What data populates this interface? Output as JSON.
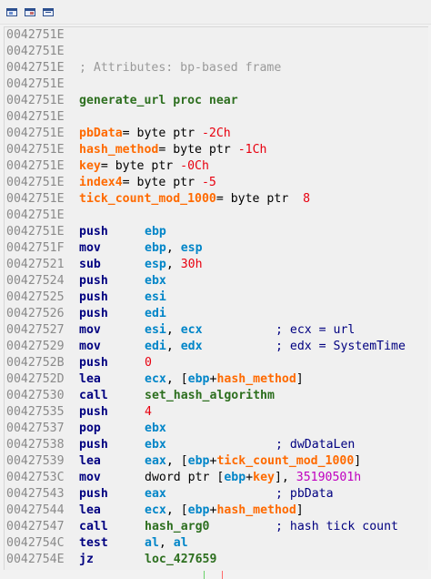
{
  "colors": {
    "address": "#8a8a8a",
    "comment_gray": "#9a9a9a",
    "procedure": "#2d6f1f",
    "variable": "#ff6a00",
    "number": "#e8000f",
    "register": "#0085c8",
    "immediate_big": "#c000c0",
    "mnemonic": "#000080"
  },
  "toolbar": {
    "icons": [
      "graph-view-icon",
      "proximity-view-icon",
      "text-view-icon"
    ]
  },
  "listing": [
    {
      "addr": "0042751E",
      "kind": "blank"
    },
    {
      "addr": "0042751E",
      "kind": "blank"
    },
    {
      "addr": "0042751E",
      "kind": "comment",
      "text": "; Attributes: bp-based frame"
    },
    {
      "addr": "0042751E",
      "kind": "blank"
    },
    {
      "addr": "0042751E",
      "kind": "proc",
      "text": "generate_url proc near"
    },
    {
      "addr": "0042751E",
      "kind": "blank"
    },
    {
      "addr": "0042751E",
      "kind": "var",
      "name": "pbData",
      "rest": "= byte ptr ",
      "off": "-2Ch"
    },
    {
      "addr": "0042751E",
      "kind": "var",
      "name": "hash_method",
      "rest": "= byte ptr ",
      "off": "-1Ch"
    },
    {
      "addr": "0042751E",
      "kind": "var",
      "name": "key",
      "rest": "= byte ptr ",
      "off": "-0Ch"
    },
    {
      "addr": "0042751E",
      "kind": "var",
      "name": "index4",
      "rest": "= byte ptr ",
      "off": "-5"
    },
    {
      "addr": "0042751E",
      "kind": "var",
      "name": "tick_count_mod_1000",
      "rest": "= byte ptr  ",
      "off": "8"
    },
    {
      "addr": "0042751E",
      "kind": "blank"
    },
    {
      "addr": "0042751E",
      "kind": "ins",
      "mn": "push",
      "ops": [
        [
          "ebp",
          "reg"
        ]
      ]
    },
    {
      "addr": "0042751F",
      "kind": "ins",
      "mn": "mov",
      "ops": [
        [
          "ebp",
          "reg"
        ],
        [
          ", ",
          "plain"
        ],
        [
          "esp",
          "reg"
        ]
      ]
    },
    {
      "addr": "00427521",
      "kind": "ins",
      "mn": "sub",
      "ops": [
        [
          "esp",
          "reg"
        ],
        [
          ", ",
          "plain"
        ],
        [
          "30h",
          "num"
        ]
      ]
    },
    {
      "addr": "00427524",
      "kind": "ins",
      "mn": "push",
      "ops": [
        [
          "ebx",
          "reg"
        ]
      ]
    },
    {
      "addr": "00427525",
      "kind": "ins",
      "mn": "push",
      "ops": [
        [
          "esi",
          "reg"
        ]
      ]
    },
    {
      "addr": "00427526",
      "kind": "ins",
      "mn": "push",
      "ops": [
        [
          "edi",
          "reg"
        ]
      ]
    },
    {
      "addr": "00427527",
      "kind": "ins",
      "mn": "mov",
      "ops": [
        [
          "esi",
          "reg"
        ],
        [
          ", ",
          "plain"
        ],
        [
          "ecx",
          "reg"
        ]
      ],
      "comment": "; ecx = url"
    },
    {
      "addr": "00427529",
      "kind": "ins",
      "mn": "mov",
      "ops": [
        [
          "edi",
          "reg"
        ],
        [
          ", ",
          "plain"
        ],
        [
          "edx",
          "reg"
        ]
      ],
      "comment": "; edx = SystemTime"
    },
    {
      "addr": "0042752B",
      "kind": "ins",
      "mn": "push",
      "ops": [
        [
          "0",
          "num"
        ]
      ]
    },
    {
      "addr": "0042752D",
      "kind": "ins",
      "mn": "lea",
      "ops": [
        [
          "ecx",
          "reg"
        ],
        [
          ", [",
          "plain"
        ],
        [
          "ebp",
          "reg"
        ],
        [
          "+",
          "plain"
        ],
        [
          "hash_method",
          "name"
        ],
        [
          "]",
          "plain"
        ]
      ]
    },
    {
      "addr": "00427530",
      "kind": "ins",
      "mn": "call",
      "ops": [
        [
          "set_hash_algorithm",
          "fn"
        ]
      ]
    },
    {
      "addr": "00427535",
      "kind": "ins",
      "mn": "push",
      "ops": [
        [
          "4",
          "num"
        ]
      ]
    },
    {
      "addr": "00427537",
      "kind": "ins",
      "mn": "pop",
      "ops": [
        [
          "ebx",
          "reg"
        ]
      ]
    },
    {
      "addr": "00427538",
      "kind": "ins",
      "mn": "push",
      "ops": [
        [
          "ebx",
          "reg"
        ]
      ],
      "comment": "; dwDataLen"
    },
    {
      "addr": "00427539",
      "kind": "ins",
      "mn": "lea",
      "ops": [
        [
          "eax",
          "reg"
        ],
        [
          ", [",
          "plain"
        ],
        [
          "ebp",
          "reg"
        ],
        [
          "+",
          "plain"
        ],
        [
          "tick_count_mod_1000",
          "name"
        ],
        [
          "]",
          "plain"
        ]
      ]
    },
    {
      "addr": "0042753C",
      "kind": "ins",
      "mn": "mov",
      "ops": [
        [
          "dword ptr [",
          "plain"
        ],
        [
          "ebp",
          "reg"
        ],
        [
          "+",
          "plain"
        ],
        [
          "key",
          "name"
        ],
        [
          "], ",
          "plain"
        ],
        [
          "35190501h",
          "big"
        ]
      ]
    },
    {
      "addr": "00427543",
      "kind": "ins",
      "mn": "push",
      "ops": [
        [
          "eax",
          "reg"
        ]
      ],
      "comment": "; pbData"
    },
    {
      "addr": "00427544",
      "kind": "ins",
      "mn": "lea",
      "ops": [
        [
          "ecx",
          "reg"
        ],
        [
          ", [",
          "plain"
        ],
        [
          "ebp",
          "reg"
        ],
        [
          "+",
          "plain"
        ],
        [
          "hash_method",
          "name"
        ],
        [
          "]",
          "plain"
        ]
      ]
    },
    {
      "addr": "00427547",
      "kind": "ins",
      "mn": "call",
      "ops": [
        [
          "hash_arg0",
          "fn"
        ]
      ],
      "comment": "; hash tick count"
    },
    {
      "addr": "0042754C",
      "kind": "ins",
      "mn": "test",
      "ops": [
        [
          "al",
          "reg"
        ],
        [
          ", ",
          "plain"
        ],
        [
          "al",
          "reg"
        ]
      ]
    },
    {
      "addr": "0042754E",
      "kind": "ins",
      "mn": "jz",
      "ops": [
        [
          "loc_427659",
          "fn"
        ]
      ]
    }
  ]
}
